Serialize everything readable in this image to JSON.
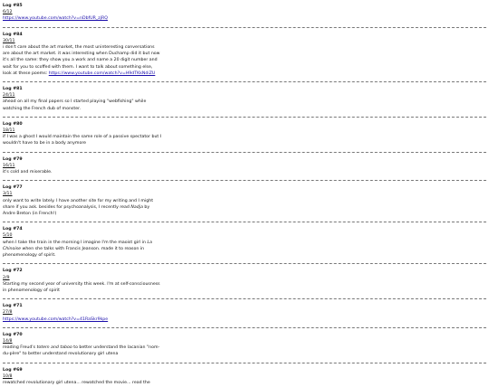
{
  "entries": [
    {
      "title": "Log #85",
      "date": "6/12",
      "parts": [],
      "link": "https://www.youtube.com/watch?v=nDbfUR_zjRQ"
    },
    {
      "title": "Log #84",
      "date": "30/11",
      "parts": [
        "i don't care about the art market, the most uninteresting conversations are about the art market. it was interesting when Duchamp did it but now it's all the same: they show you a work and name a 20 digit number and wait for you to scoffed with them. I want to talk about something else, look at these poems: "
      ],
      "link": "https://www.youtube.com/watch?v=H9dTKkNdiZU"
    },
    {
      "title": "Log #81",
      "date": "24/11",
      "parts": [
        "ahead on all my final papers so I started playing \"webfishing\" while watching the French dub of monster."
      ],
      "link": ""
    },
    {
      "title": "Log #80",
      "date": "18/11",
      "parts": [
        "if I was a ghost I would maintain the same role of a passive spectator but I wouldn't have to be in a body anymore"
      ],
      "link": ""
    },
    {
      "title": "Log #79",
      "date": "16/11",
      "parts": [
        "it's cold and miserable."
      ],
      "link": ""
    },
    {
      "title": "Log #77",
      "date": "3/11",
      "parts": [
        "only want to write lately. I have another site for my writing and I might share if you ask. besides for psychoanalysis, I recently read ",
        "Nadja",
        " by Andre Breton (in French!)"
      ],
      "link": ""
    },
    {
      "title": "Log #74",
      "date": "5/10",
      "parts": [
        "when I take the train in the morning I imagine I'm the maoist girl in ",
        "La Chinoise",
        " when she talks with Francis Jeanson. made it to reason in phenomenology of spirit."
      ],
      "link": ""
    },
    {
      "title": "Log #72",
      "date": "2/9",
      "parts": [
        "Starting my second year of university this week. I'm at self-consciousness in phenomenology of spirit"
      ],
      "link": ""
    },
    {
      "title": "Log #71",
      "date": "27/8",
      "parts": [],
      "link": "https://www.youtube.com/watch?v=41RaSkr9kpe"
    },
    {
      "title": "Log #70",
      "date": "14/8",
      "parts": [
        "reading Freud's ",
        "totem and taboo",
        " to better understand the lacanian \"nom-du-père\" to better understand revolutionary girl utena"
      ],
      "link": ""
    },
    {
      "title": "Log #69",
      "date": "10/8",
      "parts": [
        "rewatched revolutionary girl utena... rewatched the movie... read the"
      ],
      "link": ""
    }
  ]
}
